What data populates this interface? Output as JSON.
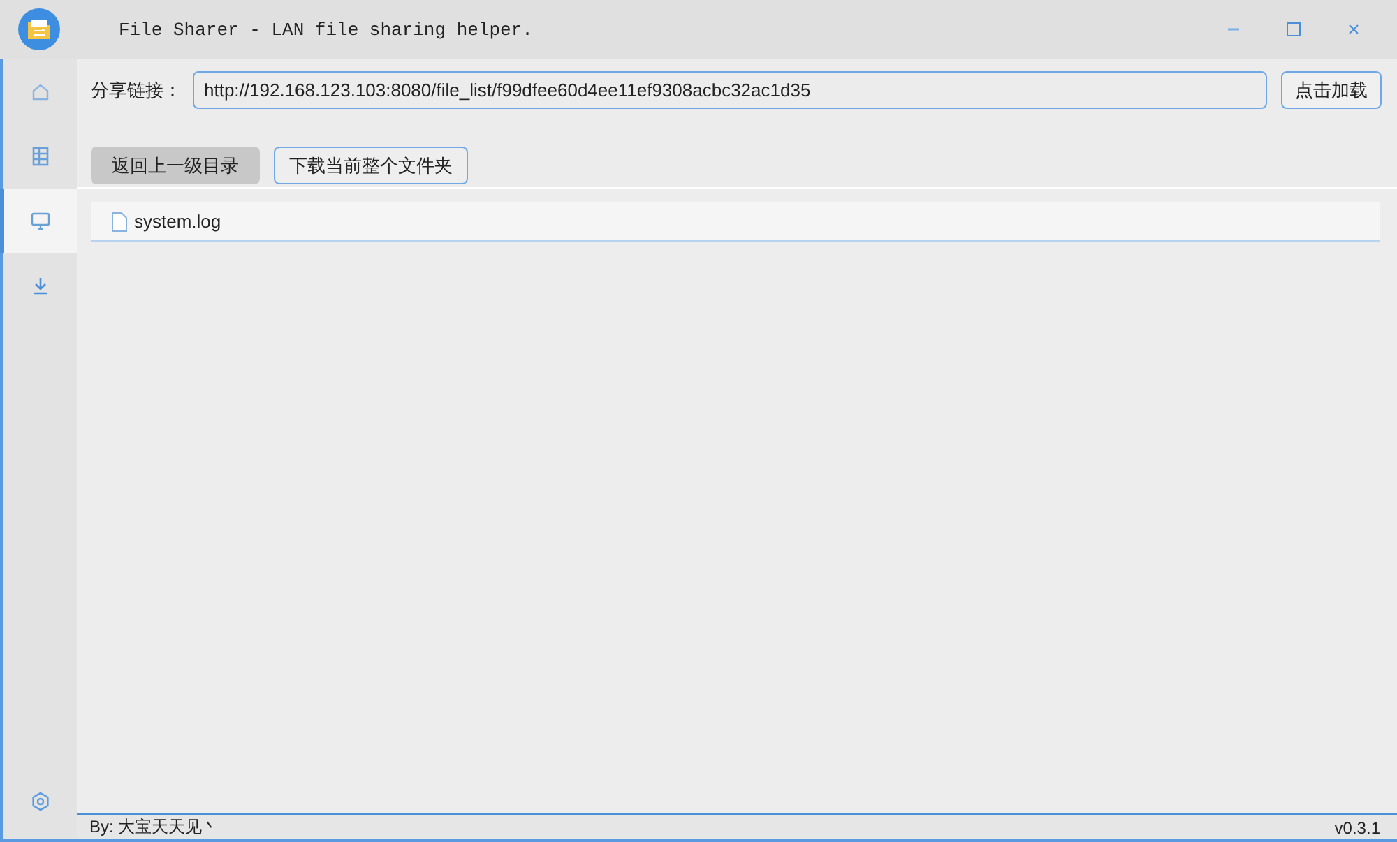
{
  "window": {
    "title": "File Sharer - LAN file sharing helper."
  },
  "sidebar": {
    "items": [
      {
        "kind": "home",
        "selected": false
      },
      {
        "kind": "table",
        "selected": false
      },
      {
        "kind": "monitor",
        "selected": true
      },
      {
        "kind": "download",
        "selected": false
      }
    ],
    "footer_item": {
      "kind": "settings",
      "selected": false
    }
  },
  "share_link": {
    "label": "分享链接：",
    "value": "http://192.168.123.103:8080/file_list/f99dfee60d4ee11ef9308acbc32ac1d35",
    "button": "点击加载"
  },
  "toolbar": {
    "buttons": [
      {
        "label": "返回上一级目录",
        "kind": "gray"
      },
      {
        "label": "下载当前整个文件夹",
        "kind": "outline"
      }
    ]
  },
  "files": [
    {
      "name": "system.log"
    }
  ],
  "status_bar": {
    "author": "By: 大宝天天见丶",
    "version": "v0.3.1"
  }
}
